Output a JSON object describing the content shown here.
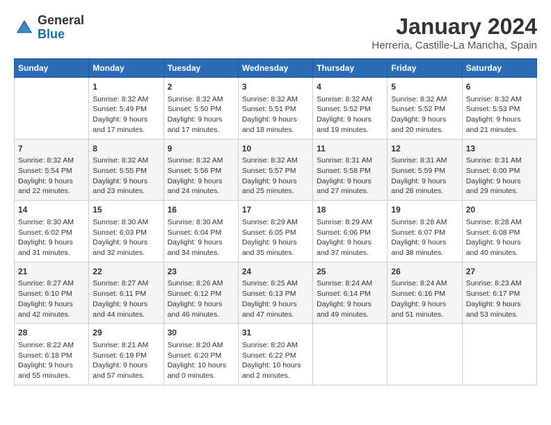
{
  "logo": {
    "general": "General",
    "blue": "Blue"
  },
  "header": {
    "month": "January 2024",
    "location": "Herreria, Castille-La Mancha, Spain"
  },
  "days_of_week": [
    "Sunday",
    "Monday",
    "Tuesday",
    "Wednesday",
    "Thursday",
    "Friday",
    "Saturday"
  ],
  "weeks": [
    [
      {
        "day": "",
        "sunrise": "",
        "sunset": "",
        "daylight": ""
      },
      {
        "day": "1",
        "sunrise": "Sunrise: 8:32 AM",
        "sunset": "Sunset: 5:49 PM",
        "daylight": "Daylight: 9 hours and 17 minutes."
      },
      {
        "day": "2",
        "sunrise": "Sunrise: 8:32 AM",
        "sunset": "Sunset: 5:50 PM",
        "daylight": "Daylight: 9 hours and 17 minutes."
      },
      {
        "day": "3",
        "sunrise": "Sunrise: 8:32 AM",
        "sunset": "Sunset: 5:51 PM",
        "daylight": "Daylight: 9 hours and 18 minutes."
      },
      {
        "day": "4",
        "sunrise": "Sunrise: 8:32 AM",
        "sunset": "Sunset: 5:52 PM",
        "daylight": "Daylight: 9 hours and 19 minutes."
      },
      {
        "day": "5",
        "sunrise": "Sunrise: 8:32 AM",
        "sunset": "Sunset: 5:52 PM",
        "daylight": "Daylight: 9 hours and 20 minutes."
      },
      {
        "day": "6",
        "sunrise": "Sunrise: 8:32 AM",
        "sunset": "Sunset: 5:53 PM",
        "daylight": "Daylight: 9 hours and 21 minutes."
      }
    ],
    [
      {
        "day": "7",
        "sunrise": "Sunrise: 8:32 AM",
        "sunset": "Sunset: 5:54 PM",
        "daylight": "Daylight: 9 hours and 22 minutes."
      },
      {
        "day": "8",
        "sunrise": "Sunrise: 8:32 AM",
        "sunset": "Sunset: 5:55 PM",
        "daylight": "Daylight: 9 hours and 23 minutes."
      },
      {
        "day": "9",
        "sunrise": "Sunrise: 8:32 AM",
        "sunset": "Sunset: 5:56 PM",
        "daylight": "Daylight: 9 hours and 24 minutes."
      },
      {
        "day": "10",
        "sunrise": "Sunrise: 8:32 AM",
        "sunset": "Sunset: 5:57 PM",
        "daylight": "Daylight: 9 hours and 25 minutes."
      },
      {
        "day": "11",
        "sunrise": "Sunrise: 8:31 AM",
        "sunset": "Sunset: 5:58 PM",
        "daylight": "Daylight: 9 hours and 27 minutes."
      },
      {
        "day": "12",
        "sunrise": "Sunrise: 8:31 AM",
        "sunset": "Sunset: 5:59 PM",
        "daylight": "Daylight: 9 hours and 28 minutes."
      },
      {
        "day": "13",
        "sunrise": "Sunrise: 8:31 AM",
        "sunset": "Sunset: 6:00 PM",
        "daylight": "Daylight: 9 hours and 29 minutes."
      }
    ],
    [
      {
        "day": "14",
        "sunrise": "Sunrise: 8:30 AM",
        "sunset": "Sunset: 6:02 PM",
        "daylight": "Daylight: 9 hours and 31 minutes."
      },
      {
        "day": "15",
        "sunrise": "Sunrise: 8:30 AM",
        "sunset": "Sunset: 6:03 PM",
        "daylight": "Daylight: 9 hours and 32 minutes."
      },
      {
        "day": "16",
        "sunrise": "Sunrise: 8:30 AM",
        "sunset": "Sunset: 6:04 PM",
        "daylight": "Daylight: 9 hours and 34 minutes."
      },
      {
        "day": "17",
        "sunrise": "Sunrise: 8:29 AM",
        "sunset": "Sunset: 6:05 PM",
        "daylight": "Daylight: 9 hours and 35 minutes."
      },
      {
        "day": "18",
        "sunrise": "Sunrise: 8:29 AM",
        "sunset": "Sunset: 6:06 PM",
        "daylight": "Daylight: 9 hours and 37 minutes."
      },
      {
        "day": "19",
        "sunrise": "Sunrise: 8:28 AM",
        "sunset": "Sunset: 6:07 PM",
        "daylight": "Daylight: 9 hours and 38 minutes."
      },
      {
        "day": "20",
        "sunrise": "Sunrise: 8:28 AM",
        "sunset": "Sunset: 6:08 PM",
        "daylight": "Daylight: 9 hours and 40 minutes."
      }
    ],
    [
      {
        "day": "21",
        "sunrise": "Sunrise: 8:27 AM",
        "sunset": "Sunset: 6:10 PM",
        "daylight": "Daylight: 9 hours and 42 minutes."
      },
      {
        "day": "22",
        "sunrise": "Sunrise: 8:27 AM",
        "sunset": "Sunset: 6:11 PM",
        "daylight": "Daylight: 9 hours and 44 minutes."
      },
      {
        "day": "23",
        "sunrise": "Sunrise: 8:26 AM",
        "sunset": "Sunset: 6:12 PM",
        "daylight": "Daylight: 9 hours and 46 minutes."
      },
      {
        "day": "24",
        "sunrise": "Sunrise: 8:25 AM",
        "sunset": "Sunset: 6:13 PM",
        "daylight": "Daylight: 9 hours and 47 minutes."
      },
      {
        "day": "25",
        "sunrise": "Sunrise: 8:24 AM",
        "sunset": "Sunset: 6:14 PM",
        "daylight": "Daylight: 9 hours and 49 minutes."
      },
      {
        "day": "26",
        "sunrise": "Sunrise: 8:24 AM",
        "sunset": "Sunset: 6:16 PM",
        "daylight": "Daylight: 9 hours and 51 minutes."
      },
      {
        "day": "27",
        "sunrise": "Sunrise: 8:23 AM",
        "sunset": "Sunset: 6:17 PM",
        "daylight": "Daylight: 9 hours and 53 minutes."
      }
    ],
    [
      {
        "day": "28",
        "sunrise": "Sunrise: 8:22 AM",
        "sunset": "Sunset: 6:18 PM",
        "daylight": "Daylight: 9 hours and 55 minutes."
      },
      {
        "day": "29",
        "sunrise": "Sunrise: 8:21 AM",
        "sunset": "Sunset: 6:19 PM",
        "daylight": "Daylight: 9 hours and 57 minutes."
      },
      {
        "day": "30",
        "sunrise": "Sunrise: 8:20 AM",
        "sunset": "Sunset: 6:20 PM",
        "daylight": "Daylight: 10 hours and 0 minutes."
      },
      {
        "day": "31",
        "sunrise": "Sunrise: 8:20 AM",
        "sunset": "Sunset: 6:22 PM",
        "daylight": "Daylight: 10 hours and 2 minutes."
      },
      {
        "day": "",
        "sunrise": "",
        "sunset": "",
        "daylight": ""
      },
      {
        "day": "",
        "sunrise": "",
        "sunset": "",
        "daylight": ""
      },
      {
        "day": "",
        "sunrise": "",
        "sunset": "",
        "daylight": ""
      }
    ]
  ]
}
